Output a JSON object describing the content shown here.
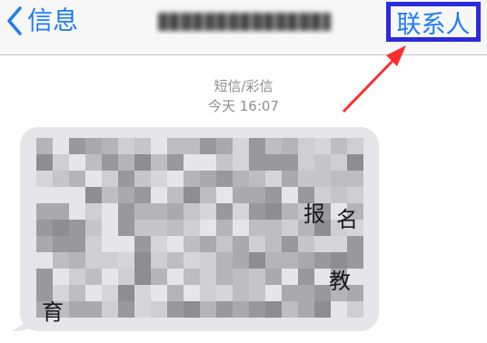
{
  "navbar": {
    "back_label": "信息",
    "title": "",
    "contact_label": "联系人"
  },
  "message": {
    "type_label": "短信/彩信",
    "timestamp": "今天 16:07",
    "visible_fragments": [
      "报",
      "名",
      "教",
      "育"
    ]
  },
  "colors": {
    "accent_blue": "#1f7cf6",
    "highlight_box": "#2b2bd9",
    "annotation_arrow": "#ff2d2d",
    "bubble": "#e5e5ea"
  },
  "icons": {
    "back": "chevron-left-icon"
  }
}
